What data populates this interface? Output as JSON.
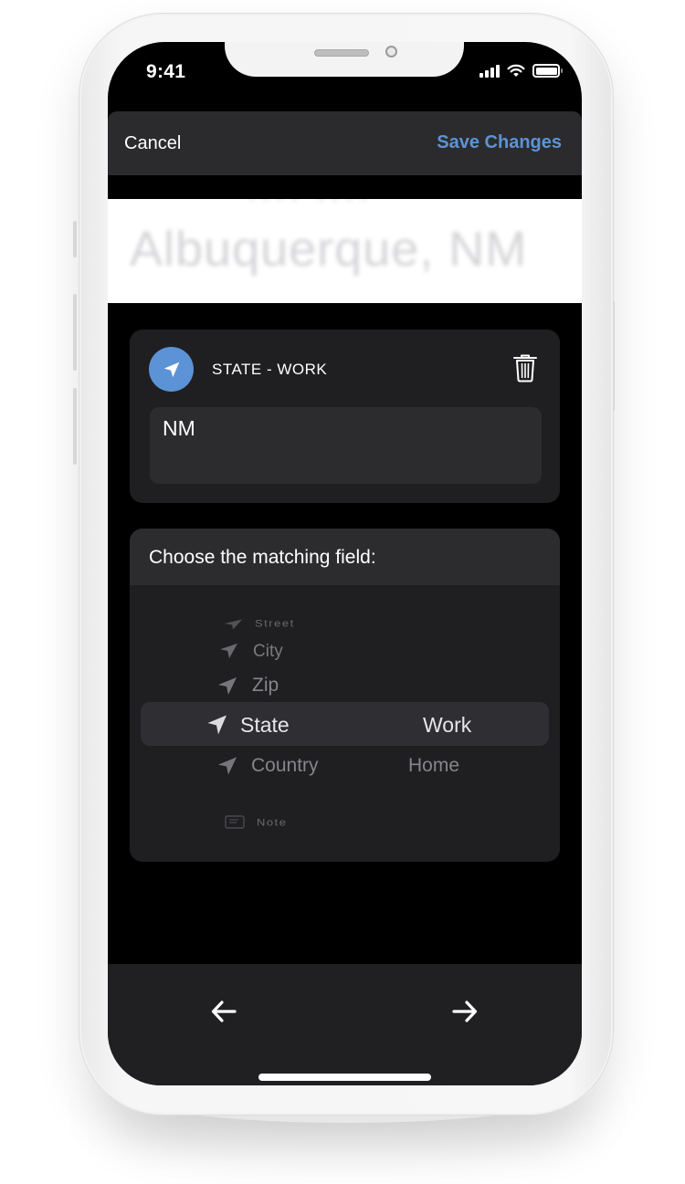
{
  "status_bar": {
    "time": "9:41",
    "icons": [
      "cellular-signal-icon",
      "wifi-icon",
      "battery-icon"
    ]
  },
  "navbar": {
    "cancel_label": "Cancel",
    "save_label": "Save Changes"
  },
  "preview": {
    "text": "Albuquerque, NM",
    "partial_text_above": "···· ····"
  },
  "field_card": {
    "icon": "location-arrow-icon",
    "title": "STATE - WORK",
    "delete_icon": "trash-icon",
    "value": "NM"
  },
  "picker": {
    "header": "Choose the matching field:",
    "rows": [
      {
        "icon": "location-arrow-icon",
        "field": "Street",
        "type": ""
      },
      {
        "icon": "location-arrow-icon",
        "field": "City",
        "type": ""
      },
      {
        "icon": "location-arrow-icon",
        "field": "Zip",
        "type": ""
      },
      {
        "icon": "location-arrow-icon",
        "field": "State",
        "type": "Work",
        "selected": true
      },
      {
        "icon": "location-arrow-icon",
        "field": "Country",
        "type": "Home"
      },
      {
        "icon": "note-icon",
        "field": "Note",
        "type": ""
      }
    ]
  },
  "bottom_bar": {
    "prev_icon": "arrow-left-icon",
    "next_icon": "arrow-right-icon"
  },
  "colors": {
    "accent": "#5c93d6",
    "background": "#000000",
    "card": "#1f1f21",
    "field": "#2c2c2e",
    "navbar": "#2b2b2d",
    "text_primary": "#ffffff",
    "text_secondary": "#85858a"
  }
}
